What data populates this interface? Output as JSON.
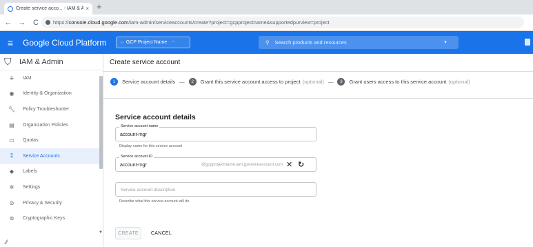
{
  "browser": {
    "tab_title": "Create service acco... - IAM & A",
    "tab_close": "×",
    "new_tab": "+",
    "back": "←",
    "forward": "→",
    "reload": "C",
    "url_prefix": "https://",
    "url_domain": "console.cloud.google.com",
    "url_path": "/iam-admin/serviceaccounts/create?project=gcpprojectname&supportedpurview=project"
  },
  "header": {
    "brand": "Google Cloud Platform",
    "project_name": "GCP Project Name",
    "search_placeholder": "Search products and resources",
    "accent": "#1a73e8"
  },
  "sidebar": {
    "title": "IAM & Admin",
    "items": [
      {
        "label": "IAM",
        "icon": "person-add-icon"
      },
      {
        "label": "Identity & Organization",
        "icon": "account-circle-icon"
      },
      {
        "label": "Policy Troubleshooter",
        "icon": "wrench-icon"
      },
      {
        "label": "Organization Policies",
        "icon": "document-icon"
      },
      {
        "label": "Quotas",
        "icon": "monitor-icon"
      },
      {
        "label": "Service Accounts",
        "icon": "service-account-icon",
        "active": true
      },
      {
        "label": "Labels",
        "icon": "tag-icon"
      },
      {
        "label": "Settings",
        "icon": "gear-icon"
      },
      {
        "label": "Privacy & Security",
        "icon": "shield-icon"
      },
      {
        "label": "Cryptographic Keys",
        "icon": "key-icon"
      }
    ]
  },
  "main": {
    "page_title": "Create service account",
    "steps": [
      {
        "num": "1",
        "label": "Service account details",
        "optional": ""
      },
      {
        "num": "2",
        "label": "Grant this service account access to project",
        "optional": "(optional)"
      },
      {
        "num": "3",
        "label": "Grant users access to this service account",
        "optional": "(optional)"
      }
    ],
    "section_title": "Service account details",
    "name_field": {
      "label": "Service account name",
      "value": "account-mgr",
      "hint": "Display name for this service account"
    },
    "id_field": {
      "label": "Service account ID",
      "value": "account-mgr",
      "suffix": "@gcpprojectname.iam.gserviceaccount.com"
    },
    "description_field": {
      "placeholder": "Service account description",
      "hint": "Describe what this service account will do"
    },
    "create_label": "CREATE",
    "cancel_label": "CANCEL"
  }
}
